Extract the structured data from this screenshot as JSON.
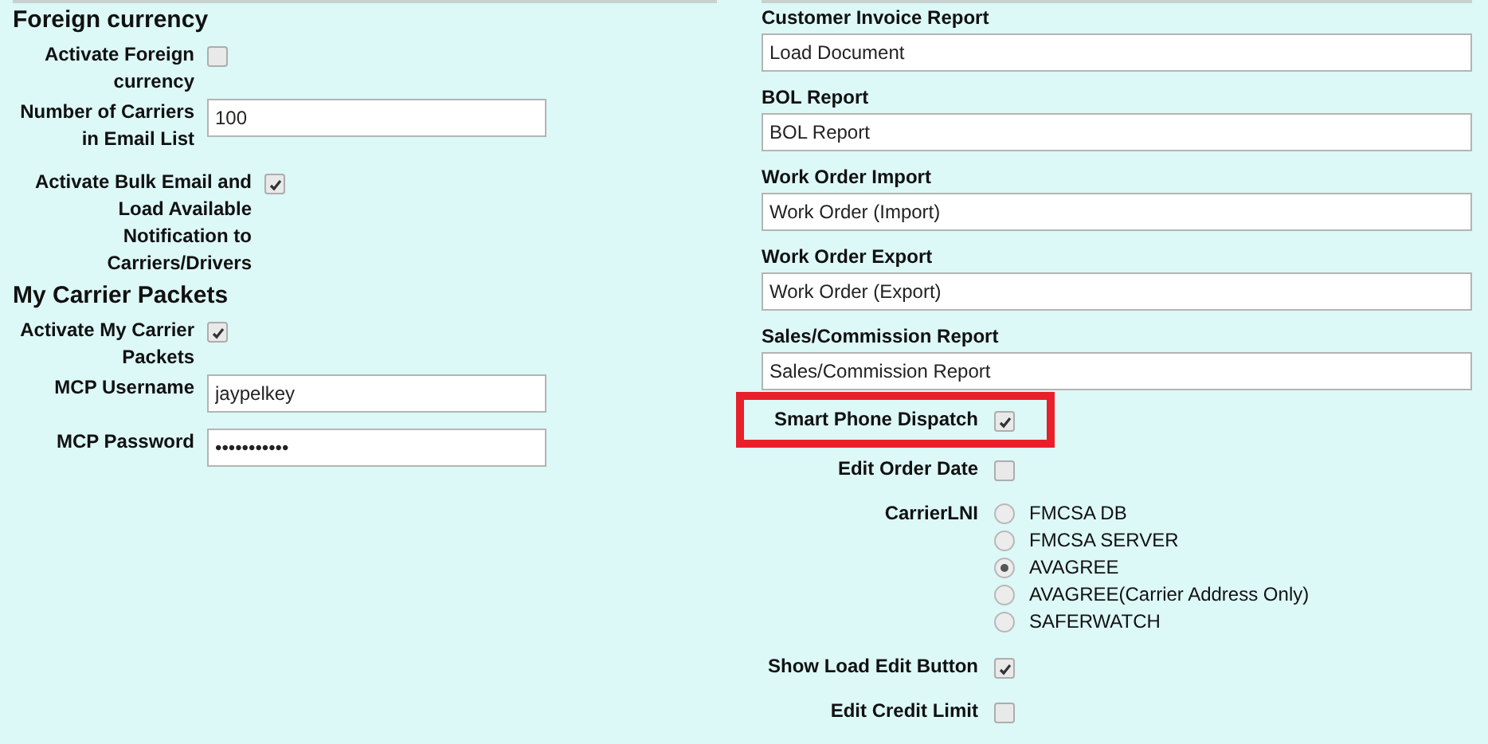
{
  "left": {
    "sections": [
      {
        "title": "Foreign currency",
        "fields": [
          {
            "kind": "checkbox",
            "label": "Activate Foreign currency",
            "checked": false,
            "wide": false
          },
          {
            "kind": "text",
            "label": "Number of Carriers in Email List",
            "value": "100",
            "wide": false
          },
          {
            "kind": "checkbox",
            "label": "Activate Bulk Email and Load Available Notification to Carriers/Drivers",
            "checked": true,
            "wide": true
          }
        ]
      },
      {
        "title": "My Carrier Packets",
        "fields": [
          {
            "kind": "checkbox",
            "label": "Activate My Carrier Packets",
            "checked": true,
            "wide": false
          },
          {
            "kind": "text",
            "label": "MCP Username",
            "value": "jaypelkey",
            "wide": false
          },
          {
            "kind": "text",
            "label": "MCP Password",
            "value": "•••••••••••",
            "wide": false
          }
        ]
      }
    ]
  },
  "right": {
    "reports": [
      {
        "label": "Customer Invoice Report",
        "value": "Load Document"
      },
      {
        "label": "BOL Report",
        "value": "BOL Report"
      },
      {
        "label": "Work Order Import",
        "value": "Work Order (Import)"
      },
      {
        "label": "Work Order Export",
        "value": "Work Order (Export)"
      },
      {
        "label": "Sales/Commission Report",
        "value": "Sales/Commission Report"
      }
    ],
    "options": [
      {
        "kind": "checkbox",
        "label": "Smart Phone Dispatch",
        "checked": true,
        "highlighted": true
      },
      {
        "kind": "checkbox",
        "label": "Edit Order Date",
        "checked": false,
        "highlighted": false
      },
      {
        "kind": "radio",
        "label": "CarrierLNI",
        "choices": [
          {
            "label": "FMCSA DB",
            "selected": false
          },
          {
            "label": "FMCSA SERVER",
            "selected": false
          },
          {
            "label": "AVAGREE",
            "selected": true
          },
          {
            "label": "AVAGREE(Carrier Address Only)",
            "selected": false
          },
          {
            "label": "SAFERWATCH",
            "selected": false
          }
        ]
      },
      {
        "kind": "checkbox",
        "label": "Show Load Edit Button",
        "checked": true,
        "highlighted": false
      },
      {
        "kind": "checkbox",
        "label": "Edit Credit Limit",
        "checked": false,
        "highlighted": false
      }
    ]
  }
}
